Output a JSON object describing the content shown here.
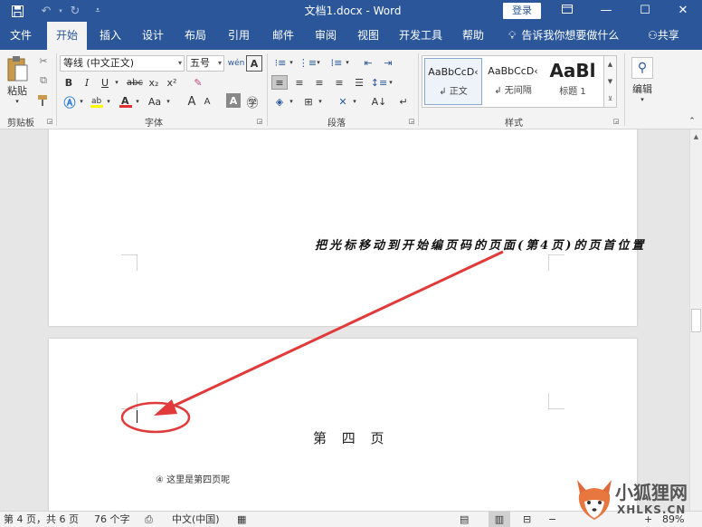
{
  "titlebar": {
    "title": "文档1.docx  -  Word",
    "login": "登录"
  },
  "menu": {
    "tabs": [
      "文件",
      "开始",
      "插入",
      "设计",
      "布局",
      "引用",
      "邮件",
      "审阅",
      "视图",
      "开发工具",
      "帮助"
    ],
    "active": "开始",
    "tell_me": "告诉我你想要做什么",
    "share": "共享"
  },
  "ribbon": {
    "clipboard": {
      "paste": "粘贴",
      "label": "剪贴板"
    },
    "font": {
      "name": "等线 (中文正文)",
      "size": "五号",
      "bold": "B",
      "italic": "I",
      "underline": "U",
      "strike": "abc",
      "subscript": "x₂",
      "superscript": "x²",
      "grow": "A",
      "shrink": "A",
      "case": "Aa",
      "label": "字体"
    },
    "paragraph": {
      "label": "段落"
    },
    "styles": {
      "items": [
        {
          "sample": "AaBbCcD‹",
          "name": "↲ 正文"
        },
        {
          "sample": "AaBbCcD‹",
          "name": "↲ 无间隔"
        },
        {
          "sample": "AaBl",
          "name": "标题 1"
        }
      ],
      "label": "样式"
    },
    "editing": {
      "label": "编辑"
    }
  },
  "document": {
    "annotation": "把光标移动到开始编页码的页面(第4页)的页首位置",
    "heading": "第 四 页",
    "paragraph": "④  这里是第四页呢"
  },
  "status": {
    "page": "第 4 页，共 6 页",
    "words": "76 个字",
    "language": "中文(中国)",
    "zoom": "89%"
  },
  "watermark": {
    "line1": "小狐狸网",
    "line2": "XHLKS.CN"
  },
  "colors": {
    "accent": "#2b579a",
    "annotation_red": "#e03a3a"
  }
}
